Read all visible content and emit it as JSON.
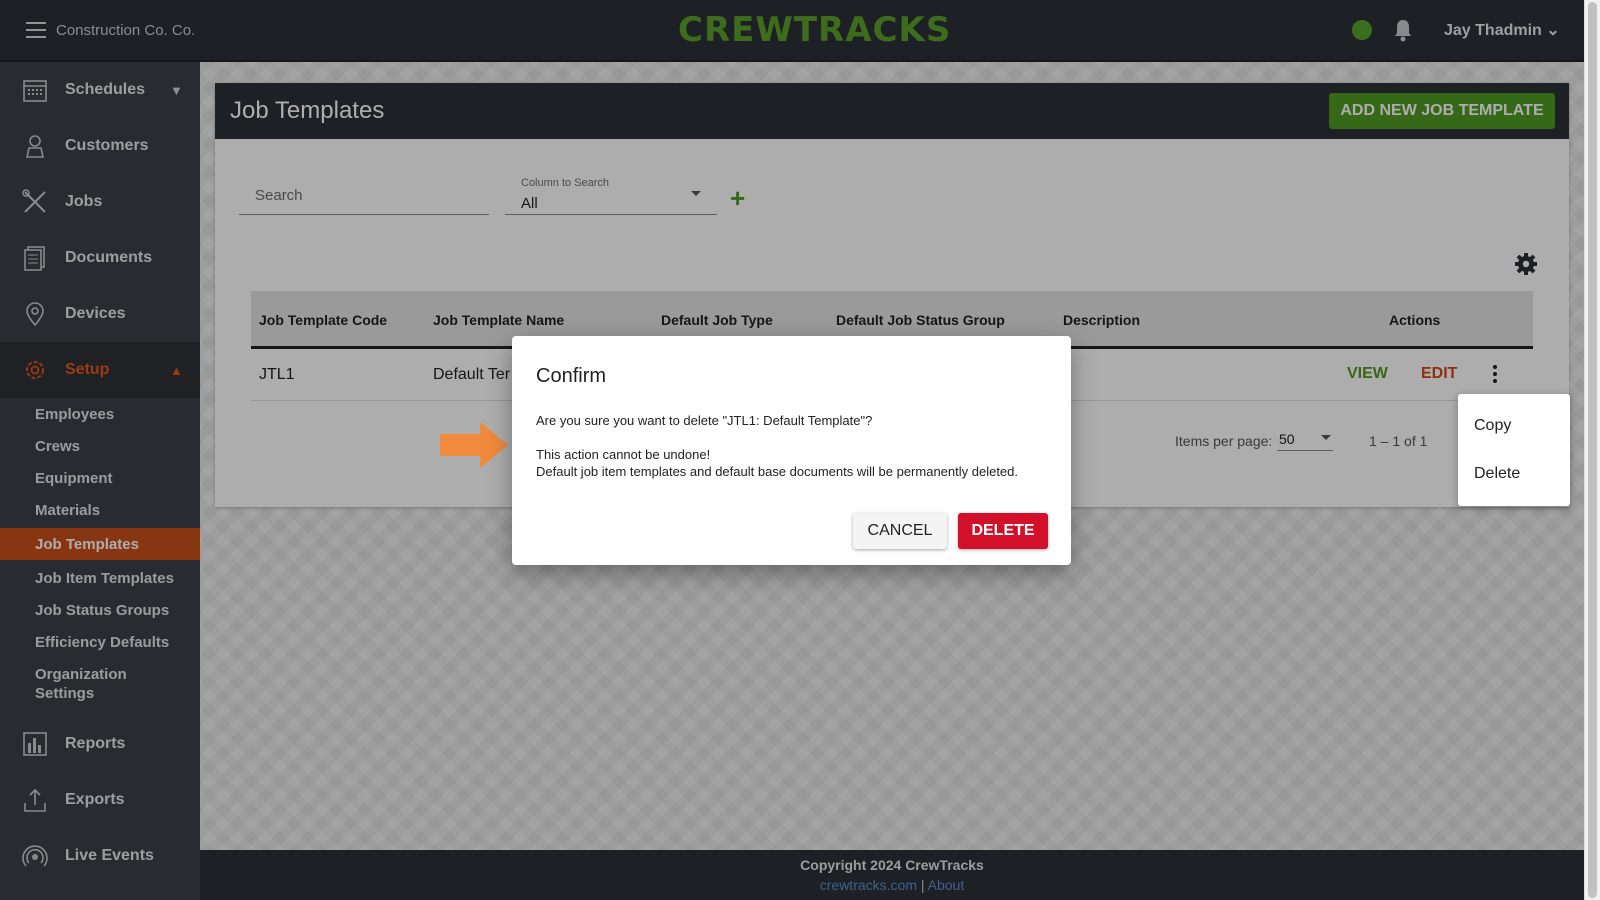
{
  "topbar": {
    "org_name": "Construction Co. Co.",
    "logo_text": "CREWTRACKS",
    "user_name": "Jay Thadmin",
    "status_color": "#56a52c"
  },
  "sidebar": {
    "items": [
      {
        "label": "Schedules",
        "icon": "calendar-icon"
      },
      {
        "label": "Customers",
        "icon": "customer-icon"
      },
      {
        "label": "Jobs",
        "icon": "tools-icon"
      },
      {
        "label": "Documents",
        "icon": "documents-icon"
      },
      {
        "label": "Devices",
        "icon": "location-pin-icon"
      },
      {
        "label": "Setup",
        "icon": "gear-icon"
      },
      {
        "label": "Reports",
        "icon": "bar-chart-icon"
      },
      {
        "label": "Exports",
        "icon": "export-icon"
      },
      {
        "label": "Live Events",
        "icon": "broadcast-icon"
      }
    ],
    "setup_sub": [
      "Employees",
      "Crews",
      "Equipment",
      "Materials",
      "Job Templates",
      "Job Item Templates",
      "Job Status Groups",
      "Efficiency Defaults",
      "Organization Settings"
    ],
    "active_sub": "Job Templates",
    "accent_color": "#c94f1a"
  },
  "page": {
    "title": "Job Templates",
    "add_button": "ADD NEW JOB TEMPLATE",
    "search_placeholder": "Search",
    "column_caption": "Column to Search",
    "column_value": "All"
  },
  "table": {
    "columns": [
      "Job Template Code",
      "Job Template Name",
      "Default Job Type",
      "Default Job Status Group",
      "Description",
      "Actions"
    ],
    "rows": [
      {
        "code": "JTL1",
        "name": "Default Ter"
      }
    ],
    "view_label": "VIEW",
    "edit_label": "EDIT"
  },
  "pagination": {
    "label": "Items per page:",
    "per_page": "50",
    "range": "1 – 1 of 1"
  },
  "row_menu": {
    "items": [
      "Copy",
      "Delete"
    ]
  },
  "dialog": {
    "title": "Confirm",
    "question": "Are you sure you want to delete \"JTL1: Default Template\"?",
    "warning_1": "This action cannot be undone!",
    "warning_2": "Default job item templates and default base documents will be permanently deleted.",
    "cancel": "CANCEL",
    "delete": "DELETE",
    "delete_color": "#d2102a"
  },
  "footer": {
    "copyright": "Copyright 2024 CrewTracks",
    "link_site": "crewtracks.com",
    "separator": "|",
    "link_about": "About"
  }
}
